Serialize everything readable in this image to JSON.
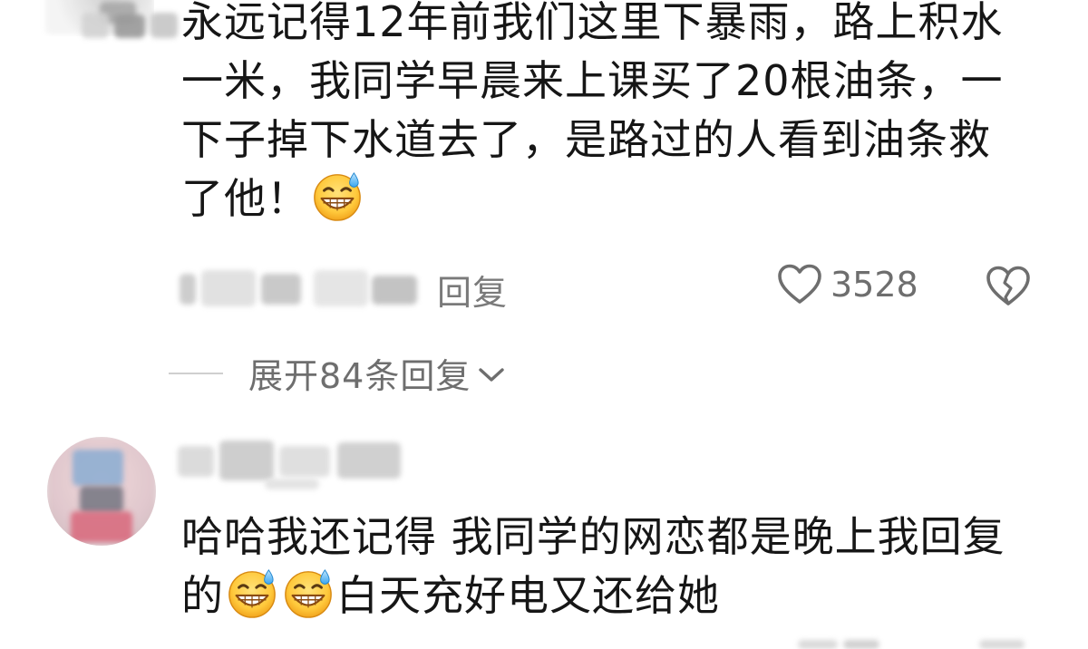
{
  "comment1": {
    "lines": [
      "永远记得12年前我们这里下暴雨，路上积水",
      "一米，我同学早晨来上课买了20根油条，一",
      "下子掉下水道去了，是路过的人看到油条救",
      "了他！"
    ],
    "emoji": "grinning-sweat-emoji",
    "reply_label": "回复",
    "like_count": "3528",
    "expand_label": "展开84条回复"
  },
  "comment2": {
    "line1": "哈哈我还记得 我同学的网恋都是晚上我回复",
    "line2_start": "的",
    "line2_end": "白天充好电又还给她",
    "emojis": [
      "grinning-sweat-emoji",
      "grinning-sweat-emoji"
    ]
  },
  "icons": {
    "like": "heart-outline-icon",
    "dislike": "broken-heart-icon",
    "expand": "chevron-down-icon"
  },
  "colors": {
    "text": "#161616",
    "meta": "#6e6e6e",
    "divider": "#cfcfcf"
  }
}
